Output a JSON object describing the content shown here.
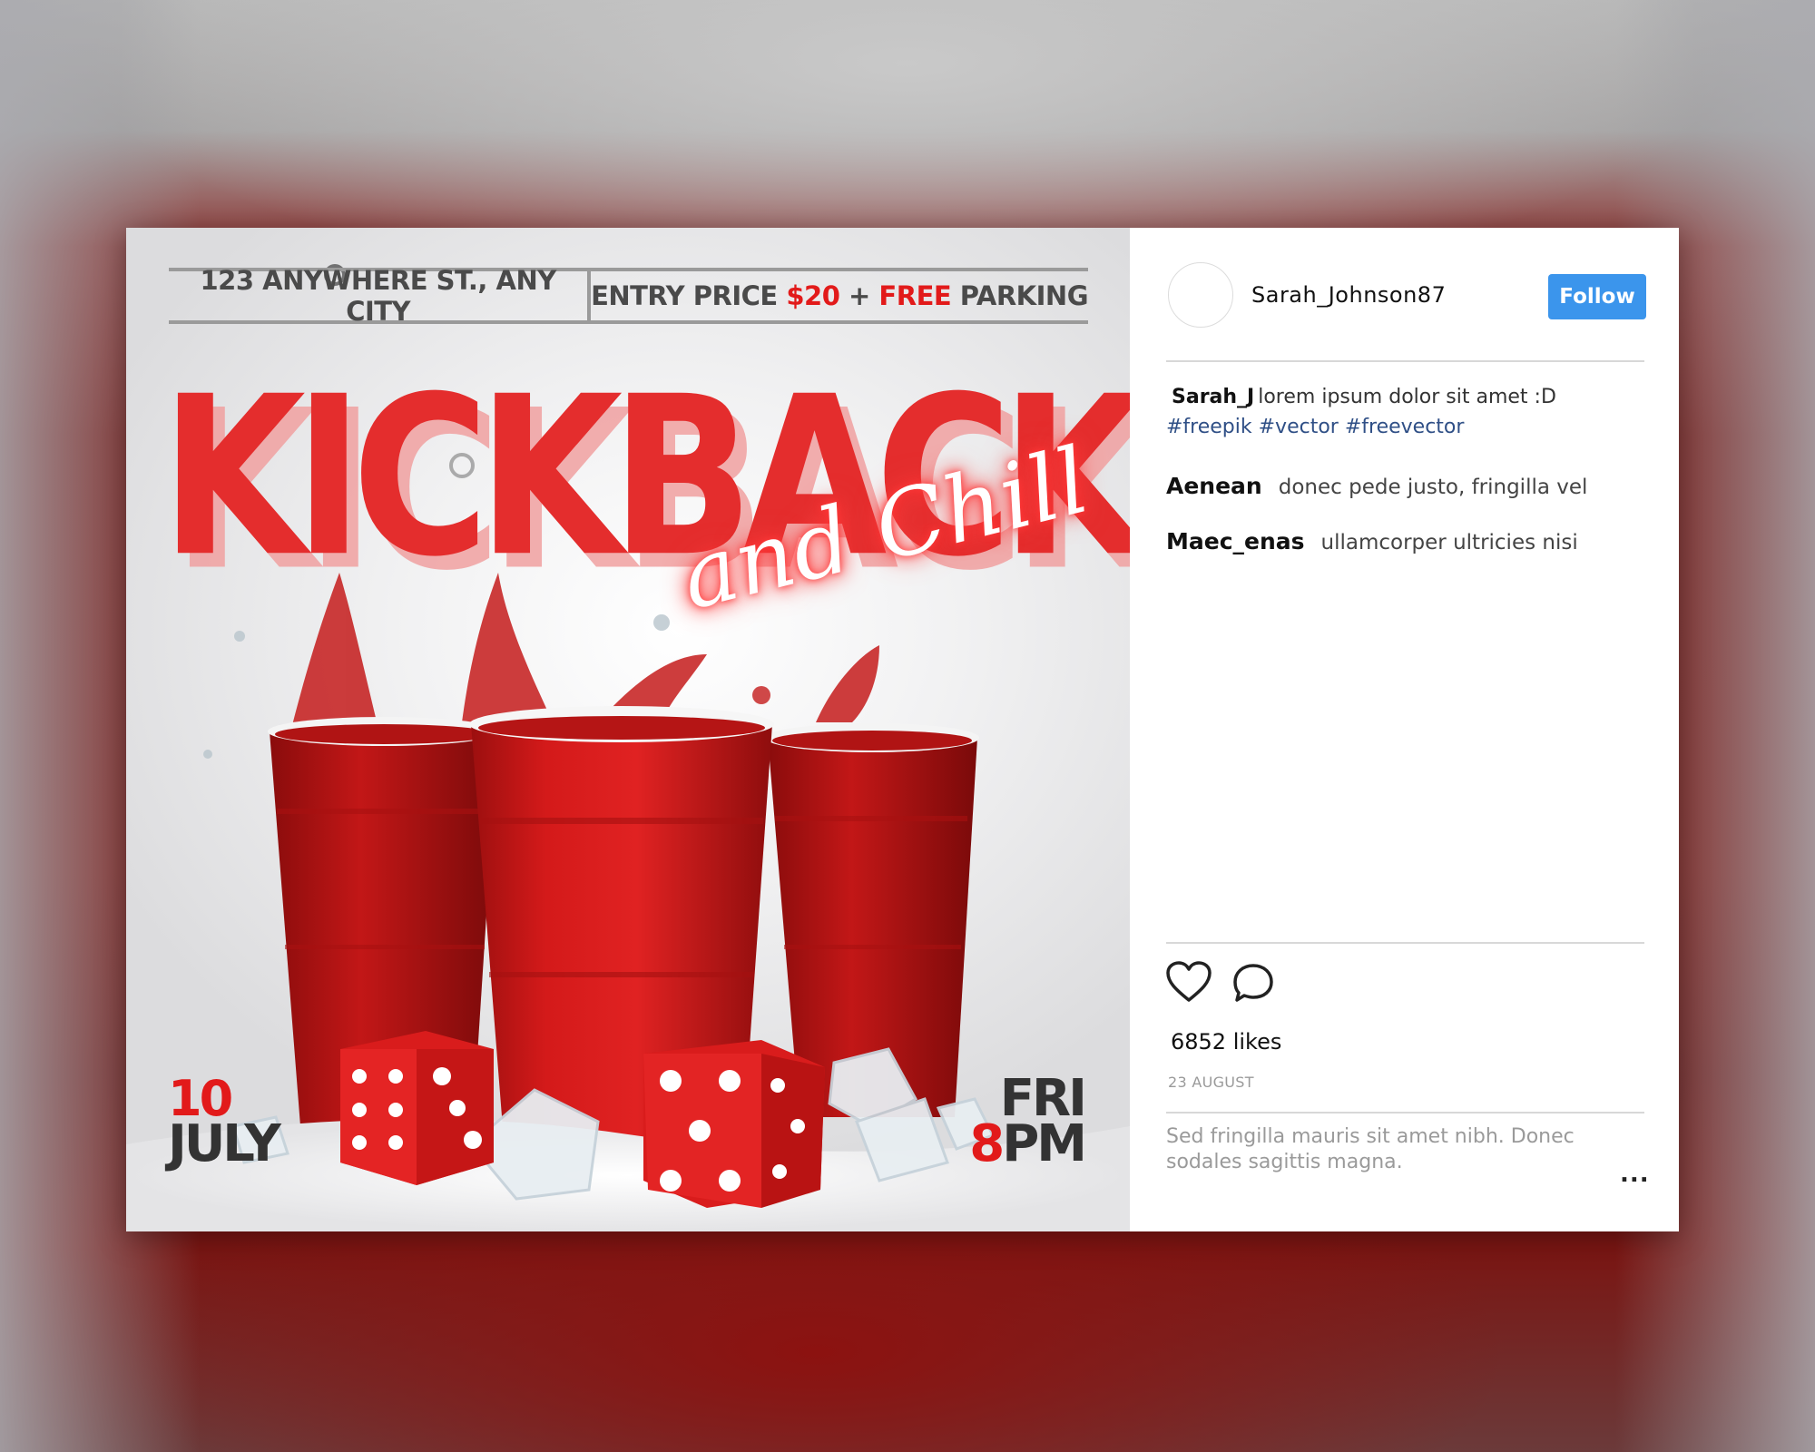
{
  "poster": {
    "address": "123 ANYWHERE ST., ANY CITY",
    "entry_label": "ENTRY PRICE",
    "price": "$20",
    "plus": "+",
    "free": "FREE",
    "parking": "PARKING",
    "title": "KICKBACK",
    "script": "and Chill",
    "date_day": "10",
    "date_month": "JULY",
    "time_day": "FRI",
    "time_hour_num": "8",
    "time_hour_suffix": "PM"
  },
  "post": {
    "username": "Sarah_Johnson87",
    "follow_label": "Follow",
    "caption_user": "Sarah_J",
    "caption_text": "lorem ipsum dolor sit amet :D",
    "caption_tags": "#freepik #vector #freevector",
    "comments": [
      {
        "user": "Aenean",
        "text": "donec pede justo, fringilla vel"
      },
      {
        "user": "Maec_enas",
        "text": "ullamcorper ultricies nisi"
      }
    ],
    "likes": "6852 likes",
    "date": "23 AUGUST",
    "comment_placeholder": "Sed fringilla mauris sit amet nibh.  Donec sodales sagittis magna.",
    "more_label": "..."
  },
  "colors": {
    "accent_red": "#e21a1a",
    "follow_blue": "#3b95ec",
    "hashtag_blue": "#2f4f86"
  },
  "icons": [
    "heart-icon",
    "comment-icon",
    "more-options-icon"
  ]
}
